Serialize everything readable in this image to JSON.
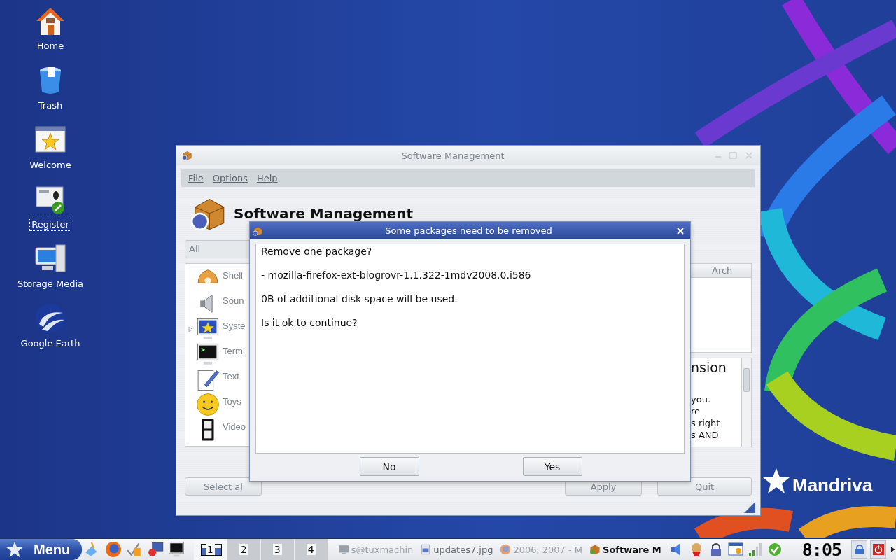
{
  "desktop_icons": [
    {
      "label": "Home",
      "selected": false
    },
    {
      "label": "Trash",
      "selected": false
    },
    {
      "label": "Welcome",
      "selected": false
    },
    {
      "label": "Register",
      "selected": true
    },
    {
      "label": "Storage Media",
      "selected": false
    },
    {
      "label": "Google Earth",
      "selected": false
    }
  ],
  "wallpaper": {
    "logo": "Mandriva"
  },
  "main_window": {
    "title": "Software Management",
    "active": false,
    "menu": [
      "File",
      "Options",
      "Help"
    ],
    "heading": "Software Management",
    "filter": "All",
    "categories": [
      {
        "label": "Shell",
        "expandable": false
      },
      {
        "label": "Soun",
        "expandable": false
      },
      {
        "label": "Syste",
        "expandable": true
      },
      {
        "label": "Termi",
        "expandable": false
      },
      {
        "label": "Text",
        "expandable": false
      },
      {
        "label": "Toys",
        "expandable": false
      },
      {
        "label": "Video",
        "expandable": false
      }
    ],
    "table_columns": [
      "Arch"
    ],
    "description": {
      "heading": "nsion",
      "lines": [
        "you.",
        "re",
        "s right",
        "s AND"
      ]
    },
    "buttons": [
      {
        "label": "Select al",
        "disabled": true
      },
      {
        "label": "Apply",
        "disabled": true
      },
      {
        "label": "Quit",
        "disabled": true
      }
    ]
  },
  "dialog": {
    "title": "Some packages need to be removed",
    "lines": [
      "Remove one package?",
      "- mozilla-firefox-ext-blogrovr-1.1.322-1mdv2008.0.i586",
      "0B of additional disk space will be used.",
      "Is it ok to continue?"
    ],
    "buttons": [
      "No",
      "Yes"
    ]
  },
  "taskbar": {
    "menu_label": "Menu",
    "workspaces": [
      {
        "label": "1",
        "selected": true
      },
      {
        "label": "2",
        "selected": false
      },
      {
        "label": "3",
        "selected": false
      },
      {
        "label": "4",
        "selected": false
      }
    ],
    "tasks": [
      {
        "label": "s@tuxmachin",
        "active": false,
        "minimized": true
      },
      {
        "label": "updates7.jpg",
        "active": false,
        "minimized": false
      },
      {
        "label": "2006, 2007 - M",
        "active": false,
        "minimized": true
      },
      {
        "label": "Software M",
        "active": true,
        "minimized": false
      }
    ],
    "clock": "8:05"
  }
}
